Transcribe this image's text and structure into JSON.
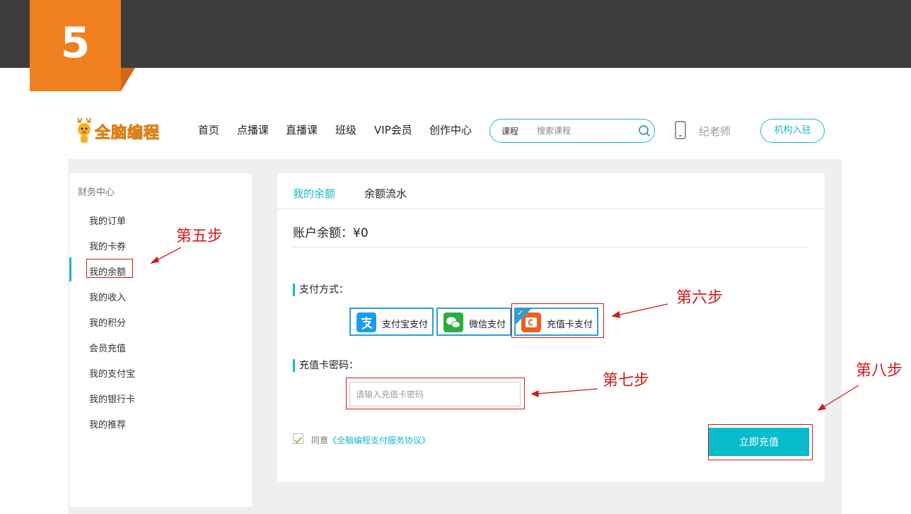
{
  "slide": {
    "step_number": "5"
  },
  "header": {
    "logo_text": "全脑编程",
    "nav": [
      "首页",
      "点播课",
      "直播课",
      "班级",
      "VIP会员",
      "创作中心"
    ],
    "search": {
      "category": "课程",
      "placeholder": "搜索课程"
    },
    "username": "纪老师",
    "org_button": "机构入驻"
  },
  "sidebar": {
    "title": "财务中心",
    "items": [
      "我的订单",
      "我的卡券",
      "我的余额",
      "我的收入",
      "我的积分",
      "会员充值",
      "我的支付宝",
      "我的银行卡",
      "我的推荐"
    ],
    "active_index": 2
  },
  "main": {
    "tabs": [
      "我的余额",
      "余额流水"
    ],
    "balance_label": "账户余额：",
    "balance_value": "¥0",
    "pay_method_label": "支付方式：",
    "pay_options": [
      "支付宝支付",
      "微信支付",
      "充值卡支付"
    ],
    "selected_pay_index": 2,
    "card_label": "充值卡密码：",
    "card_placeholder": "请输入充值卡密码",
    "agree_prefix": "同意",
    "agree_link": "《全脑编程支付服务协议》",
    "submit_label": "立即充值"
  },
  "annotations": {
    "step5": "第五步",
    "step6": "第六步",
    "step7": "第七步",
    "step8": "第八步"
  },
  "colors": {
    "accent": "#1bb6c9",
    "badge": "#f07f1f",
    "annotation": "#d11a1a",
    "alipay": "#1a9df0",
    "wechat": "#2aae3c",
    "card": "#f05f1f"
  }
}
